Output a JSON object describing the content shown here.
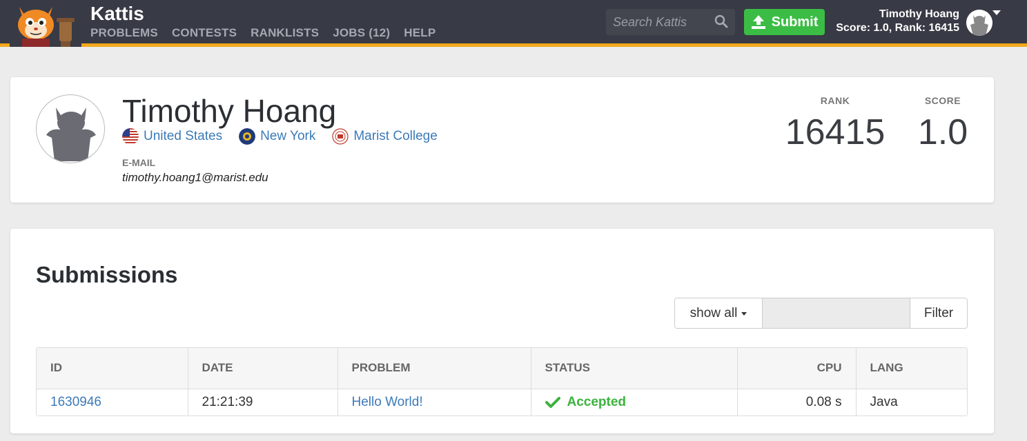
{
  "header": {
    "brand": "Kattis",
    "nav": [
      "PROBLEMS",
      "CONTESTS",
      "RANKLISTS",
      "JOBS (12)",
      "HELP"
    ],
    "search_placeholder": "Search Kattis",
    "submit_label": "Submit",
    "user_name": "Timothy Hoang",
    "user_stats": "Score: 1.0, Rank: 16415",
    "accent_color": "#f2a81d",
    "submit_color": "#3bbd45"
  },
  "profile": {
    "name": "Timothy Hoang",
    "country": "United States",
    "region": "New York",
    "school": "Marist College",
    "email_label": "E-MAIL",
    "email": "timothy.hoang1@marist.edu",
    "rank_label": "RANK",
    "rank": "16415",
    "score_label": "SCORE",
    "score": "1.0"
  },
  "submissions": {
    "title": "Submissions",
    "filter_dropdown": "show all",
    "filter_button": "Filter",
    "columns": [
      "ID",
      "DATE",
      "PROBLEM",
      "STATUS",
      "CPU",
      "LANG"
    ],
    "rows": [
      {
        "id": "1630946",
        "date": "21:21:39",
        "problem": "Hello World!",
        "status": "Accepted",
        "cpu": "0.08 s",
        "lang": "Java"
      }
    ],
    "accepted_color": "#3bb33d"
  }
}
